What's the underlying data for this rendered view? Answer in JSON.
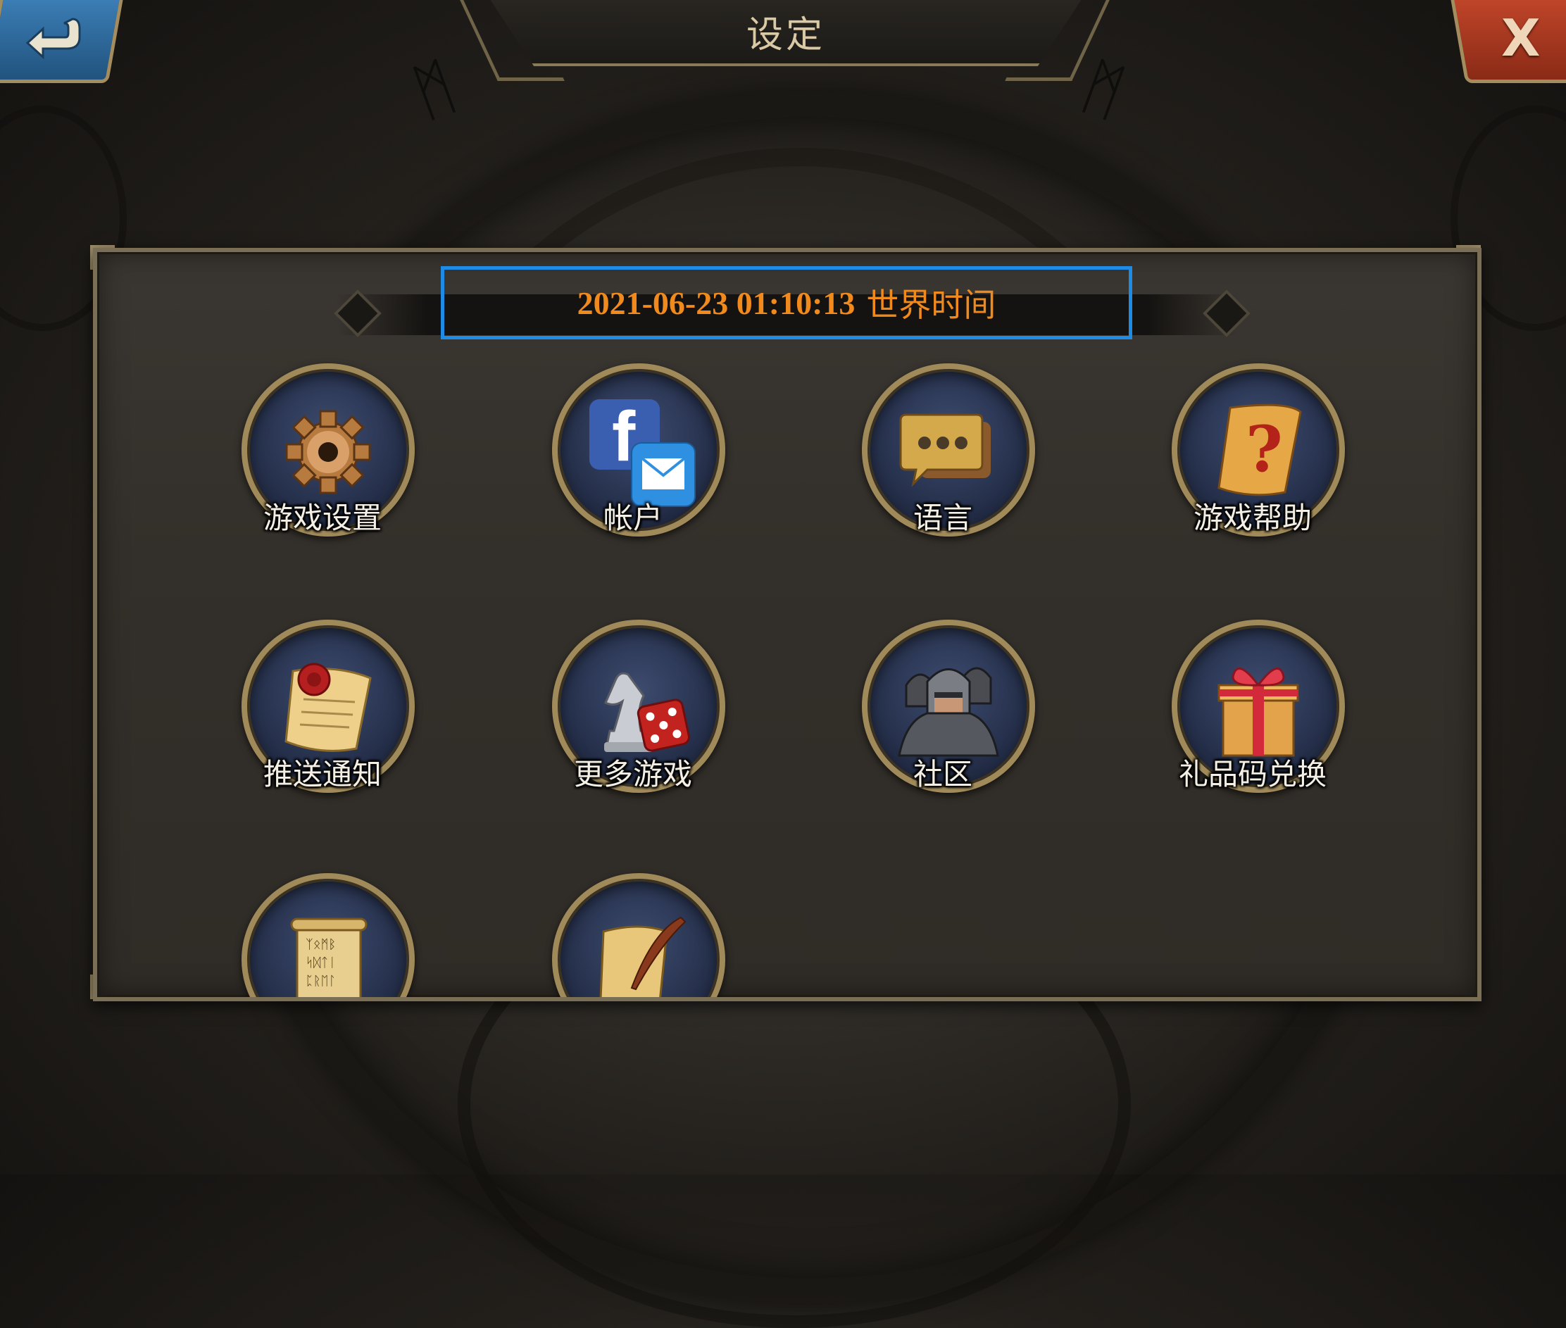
{
  "header": {
    "title": "设定",
    "back_icon": "back-arrow-icon",
    "close_label": "X"
  },
  "time": {
    "datetime": "2021-06-23 01:10:13",
    "suffix": "世界时间"
  },
  "menu": {
    "items": [
      {
        "label": "游戏设置",
        "icon": "gear-icon"
      },
      {
        "label": "帐户",
        "icon": "facebook-mail-icon"
      },
      {
        "label": "语言",
        "icon": "chat-bubble-icon"
      },
      {
        "label": "游戏帮助",
        "icon": "help-scroll-icon"
      },
      {
        "label": "推送通知",
        "icon": "sealed-scroll-icon"
      },
      {
        "label": "更多游戏",
        "icon": "chess-dice-icon"
      },
      {
        "label": "社区",
        "icon": "knights-icon"
      },
      {
        "label": "礼品码兑换",
        "icon": "gift-box-icon"
      },
      {
        "label": "",
        "icon": "rune-scroll-icon"
      },
      {
        "label": "",
        "icon": "quill-scroll-icon"
      }
    ]
  },
  "colors": {
    "accent_time": "#f08a1c",
    "highlight_border": "#1e8ce6",
    "back_button": "#2f6ea3",
    "close_button": "#b23c22"
  }
}
